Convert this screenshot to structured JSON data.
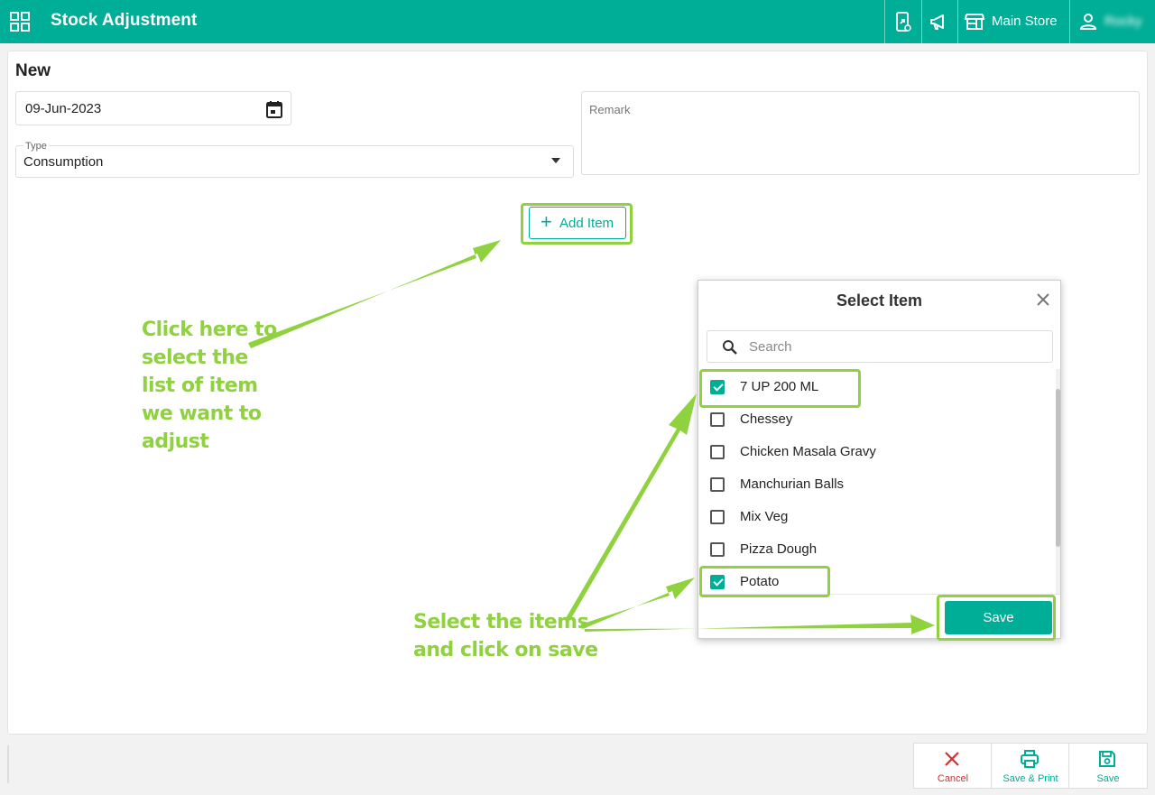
{
  "header": {
    "title": "Stock Adjustment",
    "store_label": "Main Store",
    "user_name": "Rocky"
  },
  "page": {
    "heading": "New"
  },
  "form": {
    "date_value": "09-Jun-2023",
    "type_label": "Type",
    "type_value": "Consumption",
    "remark_placeholder": "Remark",
    "add_item_label": "Add Item"
  },
  "dialog": {
    "title": "Select Item",
    "search_placeholder": "Search",
    "items": [
      {
        "label": "7 UP 200 ML",
        "checked": true
      },
      {
        "label": "Chessey",
        "checked": false
      },
      {
        "label": "Chicken Masala Gravy",
        "checked": false
      },
      {
        "label": "Manchurian Balls",
        "checked": false
      },
      {
        "label": "Mix Veg",
        "checked": false
      },
      {
        "label": "Pizza Dough",
        "checked": false
      },
      {
        "label": "Potato",
        "checked": true
      }
    ],
    "save_label": "Save"
  },
  "footer": {
    "cancel_label": "Cancel",
    "save_print_label": "Save & Print",
    "save_label": "Save"
  },
  "annotations": {
    "add_item_note": [
      "Click here to",
      "select the",
      "list of item",
      "we want to",
      "adjust"
    ],
    "save_note": [
      "Select the items",
      "and click on save"
    ]
  },
  "colors": {
    "primary": "#00ad96",
    "annotation": "#8fd13f",
    "cancel": "#d32f2f"
  }
}
